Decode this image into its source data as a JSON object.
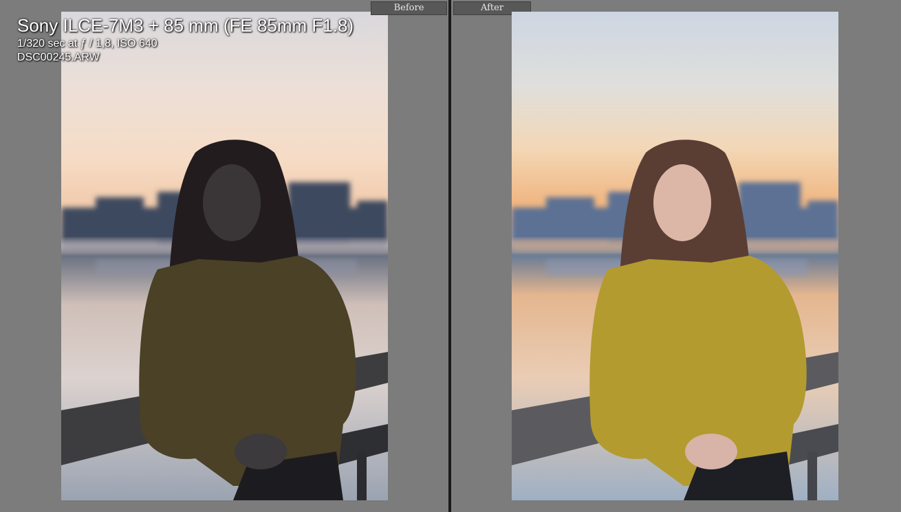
{
  "compare_view": {
    "before_label": "Before",
    "after_label": "After"
  },
  "info_overlay": {
    "camera_lens": "Sony ILCE-7M3 + 85 mm (FE 85mm F1.8)",
    "exposure": "1/320 sec at ƒ / 1,8, ISO 640",
    "filename": "DSC00245.ARW"
  },
  "colors": {
    "background": "#7c7c7c",
    "divider": "#1a1a1a",
    "tab": "#585858"
  }
}
